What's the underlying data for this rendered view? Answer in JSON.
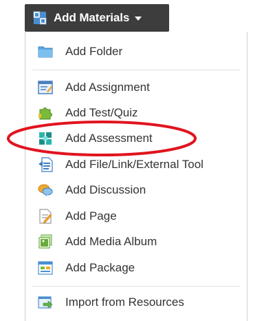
{
  "button": {
    "label": "Add Materials",
    "icon": "add-materials-icon"
  },
  "menu": {
    "items": [
      {
        "label": "Add Folder",
        "icon": "folder-icon",
        "color": "#5aa8e0"
      },
      {
        "label": "Add Assignment",
        "icon": "assignment-icon",
        "color": "#4a7fc1"
      },
      {
        "label": "Add Test/Quiz",
        "icon": "puzzle-icon",
        "color": "#7bbb3a"
      },
      {
        "label": "Add Assessment",
        "icon": "assessment-icon",
        "color": "#2bb5b0"
      },
      {
        "label": "Add File/Link/External Tool",
        "icon": "file-link-icon",
        "color": "#3a7cc2"
      },
      {
        "label": "Add Discussion",
        "icon": "discussion-icon",
        "color": "#f0a830"
      },
      {
        "label": "Add Page",
        "icon": "page-icon",
        "color": "#9a9a9a"
      },
      {
        "label": "Add Media Album",
        "icon": "media-album-icon",
        "color": "#6aab3e"
      },
      {
        "label": "Add Package",
        "icon": "package-icon",
        "color": "#4a8ed0"
      },
      {
        "label": "Import from Resources",
        "icon": "import-icon",
        "color": "#5fb246"
      }
    ]
  },
  "annotation": {
    "color": "#e0141e",
    "target": "Add Assessment"
  }
}
